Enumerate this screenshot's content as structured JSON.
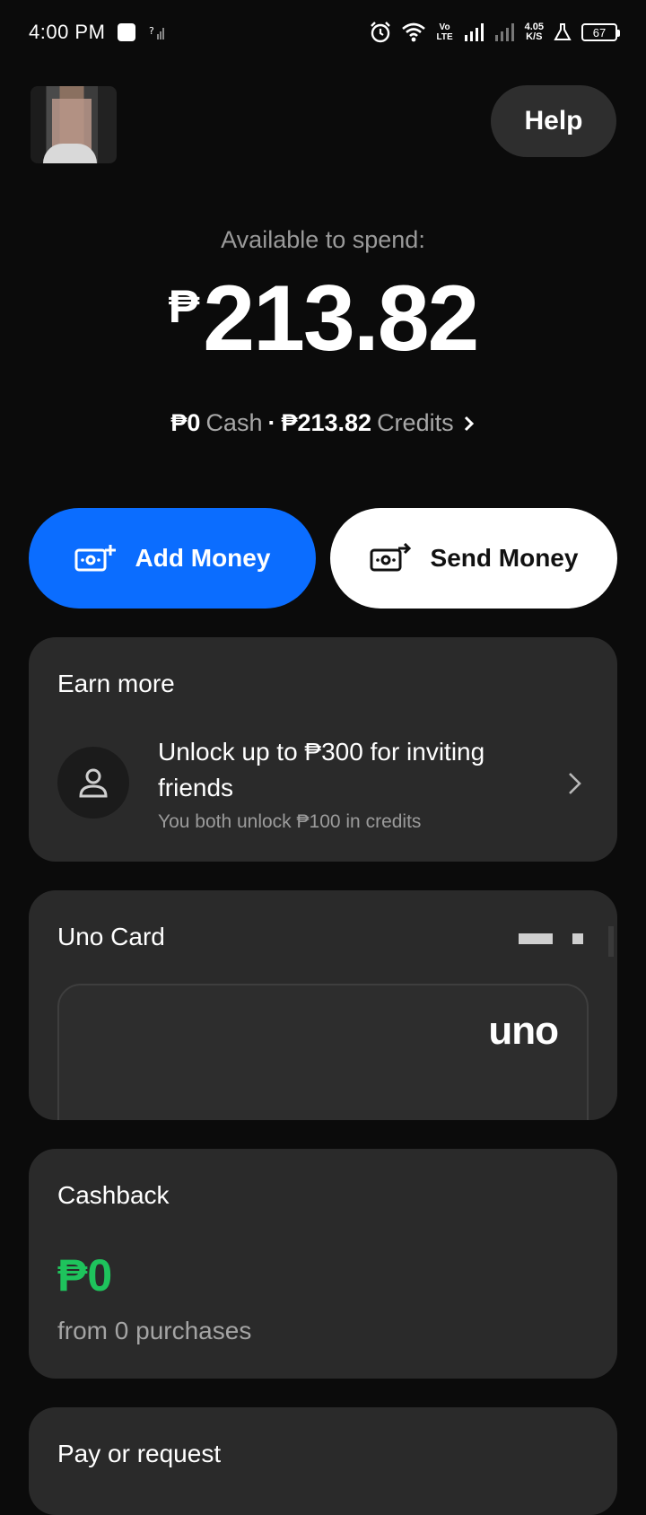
{
  "status_bar": {
    "time": "4:00 PM",
    "network_speed_top": "4.05",
    "network_speed_bottom": "K/S",
    "volte": "Vo LTE",
    "battery": "67"
  },
  "header": {
    "help_label": "Help"
  },
  "balance": {
    "label": "Available to spend:",
    "currency": "₱",
    "amount": "213.82",
    "cash_amount": "₱0",
    "cash_label": "Cash",
    "separator": "·",
    "credits_amount": "₱213.82",
    "credits_label": "Credits"
  },
  "actions": {
    "add_money": "Add Money",
    "send_money": "Send Money"
  },
  "earn_more": {
    "title": "Earn more",
    "headline": "Unlock up to ₱300 for inviting friends",
    "subtext": "You both unlock ₱100 in credits"
  },
  "uno_card": {
    "title": "Uno Card",
    "logo": "uno"
  },
  "cashback": {
    "title": "Cashback",
    "amount": "₱0",
    "subtext": "from 0 purchases"
  },
  "pay_request": {
    "title": "Pay or request"
  },
  "colors": {
    "background": "#0b0b0b",
    "card": "#2a2a2a",
    "accent_blue": "#0b6dff",
    "cashback_green": "#1ec35c"
  }
}
